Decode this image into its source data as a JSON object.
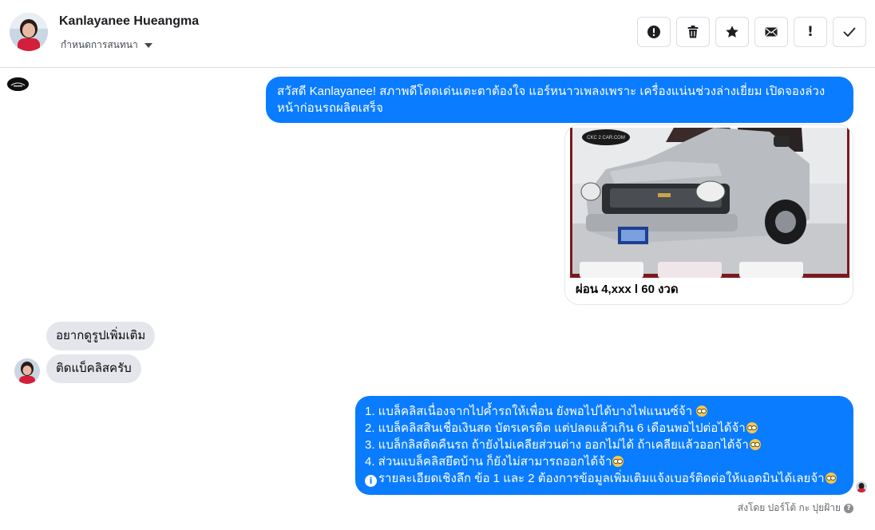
{
  "header": {
    "contact_name": "Kanlayanee Hueangma",
    "nickname_action": "กำหนดการสนทนา"
  },
  "toolbar": {
    "buttons": [
      {
        "name": "report-spam",
        "icon": "alert-circle-icon"
      },
      {
        "name": "delete",
        "icon": "trash-icon"
      },
      {
        "name": "star",
        "icon": "star-icon"
      },
      {
        "name": "mark-unread",
        "icon": "envelope-icon"
      },
      {
        "name": "follow-up",
        "icon": "exclamation-icon",
        "glyph": "!"
      },
      {
        "name": "mark-done",
        "icon": "check-icon"
      }
    ]
  },
  "messages": {
    "outgoing_1": "สวัสดี Kanlayanee! สภาพดีโดดเด่นเตะตาต้องใจ แอร์หนาวเพลงเพราะ เครื่องแน่นช่วงล่างเยี่ยม เปิดจองล่วงหน้าก่อนรถผลิตเสร็จ",
    "card": {
      "title": "ผ่อน 4,xxx l 60 งวด",
      "watermark": "CKC 2 CAR.COM"
    },
    "incoming_1": "อยากดูรูปเพิ่มเติม",
    "incoming_2": "ติดแบ็คลิสครับ",
    "outgoing_2_lines": [
      "1. แบล็คลิสเนื่องจากไปค้ำรถให้เพื่อน ยังพอไปได้บางไฟแนนซ์จ้า",
      "2. แบล็คลิสสินเชื่อเงินสด บัตรเครดิต แต่ปลดแล้วเกิน 6 เดือนพอไปต่อได้จ้า",
      "3. แบล็กลิสติดคืนรถ ถ้ายังไม่เคลียส่วนต่าง ออกไม่ได้ ถ้าเคลียแล้วออกได้จ้า",
      "4. ส่วนแบล็คลิสยึดบ้าน ก็ยังไม่สามารถออกได้จ้า",
      "รายละเอียดเชิงลึก ข้อ 1 และ 2 ต้องการข้อมูลเพิ่มเติมแจ้งเบอร์ติดต่อให้แอดมินได้เลยจ้า"
    ],
    "sent_by": "ส่งโดย ปอร์โต้ กะ ปุยฝ้าย",
    "help_glyph": "?",
    "info_glyph": "i"
  },
  "colors": {
    "outgoing_bubble": "#0a7cff",
    "incoming_bubble": "#e4e6eb",
    "border": "#dadde1"
  }
}
